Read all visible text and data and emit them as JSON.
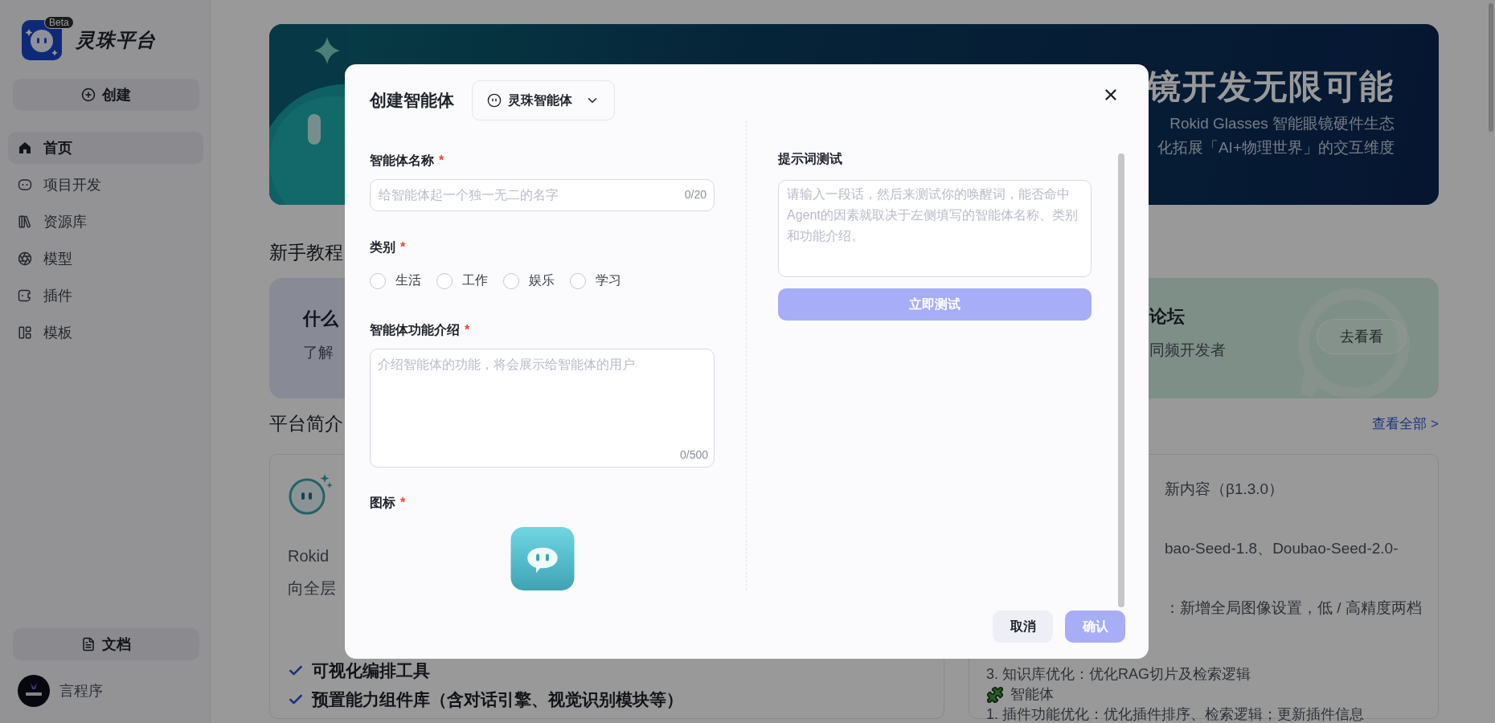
{
  "sidebar": {
    "logo": {
      "name": "灵珠平台",
      "badge": "Beta"
    },
    "create_button": "创建",
    "nav_items": [
      {
        "kind": "home",
        "label": "首页",
        "selected": true
      },
      {
        "kind": "project",
        "label": "项目开发",
        "selected": false
      },
      {
        "kind": "library",
        "label": "资源库",
        "selected": false
      },
      {
        "kind": "model",
        "label": "模型",
        "selected": false
      },
      {
        "kind": "plugin",
        "label": "插件",
        "selected": false
      },
      {
        "kind": "template",
        "label": "模板",
        "selected": false
      }
    ],
    "docs_button": "文档",
    "user": {
      "name": "言程序"
    }
  },
  "banner": {
    "title": "镜开发无限可能",
    "lines": [
      "Rokid Glasses 智能眼镜硬件生态",
      "化拓展「AI+物理世界」的交互维度"
    ]
  },
  "tutorials": {
    "heading": "新手教程",
    "intro_card": {
      "title": "什么",
      "subtitle": "了解"
    },
    "forum_card": {
      "title": "论坛",
      "subtitle": "同频开发者",
      "button": "去看看"
    }
  },
  "platform": {
    "heading": "平台简介",
    "view_all": "查看全部 >",
    "intro_card": {
      "lines": [
        "Rokid",
        "向全层"
      ],
      "features": [
        "可视化编排工具",
        "预置能力组件库（含对话引擎、视觉识别模块等）"
      ]
    },
    "updates_card": {
      "title": "新内容（β1.3.0）",
      "lines": [
        "bao-Seed-1.8、Doubao-Seed-2.0-",
        "：新增全局图像设置，低 / 高精度两档"
      ],
      "items": [
        {
          "kind": "text",
          "text": "3. 知识库优化：优化RAG切片及检索逻辑"
        },
        {
          "kind": "section",
          "text": "智能体"
        },
        {
          "kind": "text",
          "text": "1. 插件功能优化：优化插件排序、检索逻辑；更新插件信息"
        }
      ]
    }
  },
  "modal": {
    "title": "创建智能体",
    "agent_select": "灵珠智能体",
    "name_field": {
      "label": "智能体名称",
      "required_mark": "*",
      "placeholder": "给智能体起一个独一无二的名字",
      "counter": "0/20"
    },
    "category": {
      "label": "类别",
      "required_mark": "*",
      "options": [
        {
          "label": "生活",
          "selected": false
        },
        {
          "label": "工作",
          "selected": false
        },
        {
          "label": "娱乐",
          "selected": false
        },
        {
          "label": "学习",
          "selected": false
        }
      ]
    },
    "description_field": {
      "label": "智能体功能介绍",
      "required_mark": "*",
      "placeholder": "介绍智能体的功能，将会展示给智能体的用户",
      "counter": "0/500"
    },
    "icon_field": {
      "label": "图标",
      "required_mark": "*"
    },
    "prompt_test": {
      "label": "提示词测试",
      "placeholder": "请输入一段话，然后来测试你的唤醒词，能否命中Agent的因素就取决于左侧填写的智能体名称、类别和功能介绍。",
      "button": {
        "label": "立即测试",
        "disabled": true
      }
    },
    "cancel_button": {
      "label": "取消",
      "disabled": false
    },
    "confirm_button": {
      "label": "确认",
      "disabled": true
    }
  }
}
